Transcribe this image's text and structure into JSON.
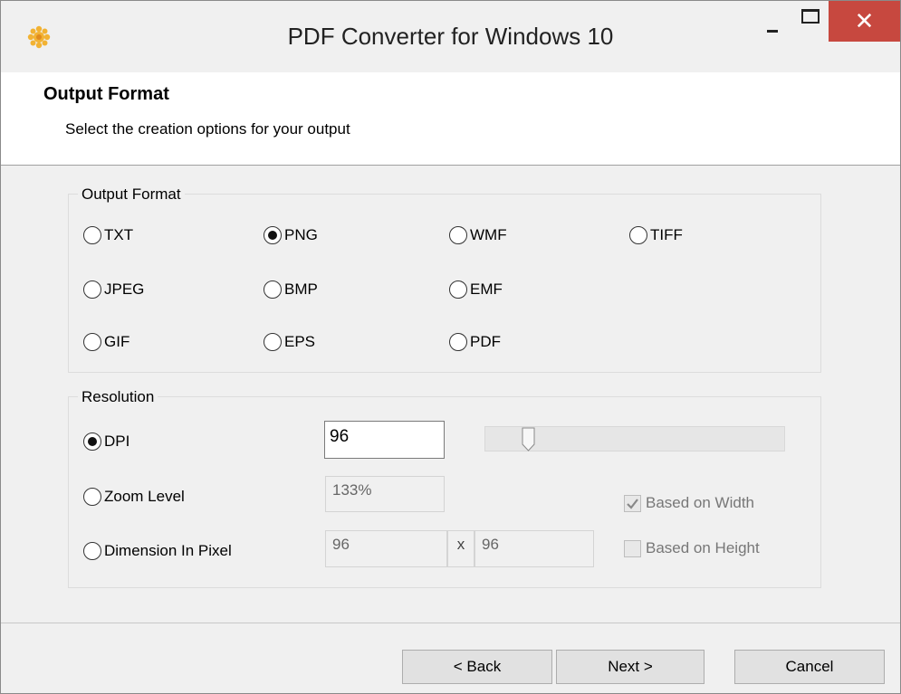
{
  "window": {
    "title": "PDF Converter for Windows 10",
    "app_icon": "sun-gear-icon",
    "controls": {
      "minimize_icon": "minimize-icon",
      "maximize_icon": "maximize-icon",
      "close_label": "✕"
    }
  },
  "header": {
    "title": "Output Format",
    "subtitle": "Select the creation options for your output"
  },
  "output_format": {
    "legend": "Output Format",
    "selected": "PNG",
    "options": [
      "TXT",
      "PNG",
      "WMF",
      "TIFF",
      "JPEG",
      "BMP",
      "EMF",
      "GIF",
      "EPS",
      "PDF"
    ]
  },
  "resolution": {
    "legend": "Resolution",
    "selected": "DPI",
    "dpi": {
      "label": "DPI",
      "value": "96"
    },
    "zoom": {
      "label": "Zoom Level",
      "value": "133%"
    },
    "dimension": {
      "label": "Dimension In Pixel",
      "width": "96",
      "separator": "x",
      "height": "96"
    },
    "slider_level_fraction": 0.13,
    "based_on_width": {
      "label": "Based on Width",
      "checked": true
    },
    "based_on_height": {
      "label": "Based on Height",
      "checked": false
    }
  },
  "buttons": {
    "back": "< Back",
    "next": "Next >",
    "cancel": "Cancel"
  },
  "colors": {
    "close_button": "#c7483f",
    "header_bg": "#ffffff",
    "window_bg": "#f0f0f0"
  }
}
